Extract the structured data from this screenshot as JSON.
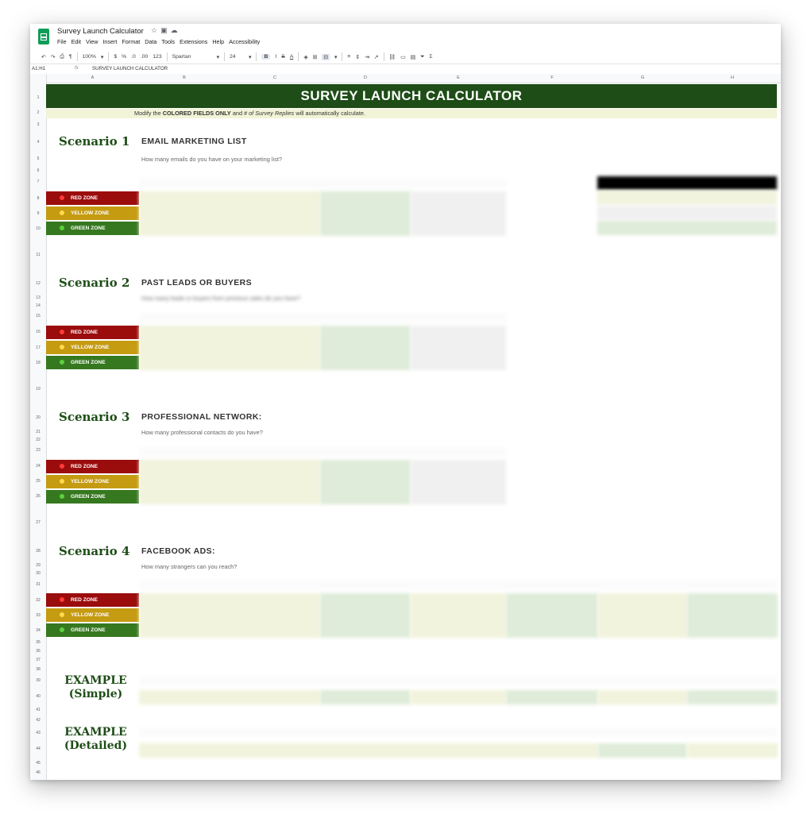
{
  "app": {
    "doc_title": "Survey Launch Calculator",
    "menu": [
      "File",
      "Edit",
      "View",
      "Insert",
      "Format",
      "Data",
      "Tools",
      "Extensions",
      "Help",
      "Accessibility"
    ],
    "toolbar": {
      "zoom": "100%",
      "currency": "$",
      "percent": "%",
      "decimal_less": ".0",
      "decimal_more": ".00",
      "format_more": "123",
      "font": "Spartan",
      "font_size": "24",
      "bold": "B",
      "italic": "I",
      "strike": "S",
      "text_color": "A"
    },
    "name_box": "A1:H1",
    "fx": "fx",
    "formula": "SURVEY LAUNCH CALCULATOR"
  },
  "columns": [
    "A",
    "B",
    "C",
    "D",
    "E",
    "F",
    "G",
    "H"
  ],
  "rows": [
    "1",
    "2",
    "3",
    "4",
    "5",
    "6",
    "7",
    "8",
    "9",
    "10",
    "11",
    "12",
    "13",
    "14",
    "15",
    "16",
    "17",
    "18",
    "19",
    "20",
    "21",
    "22",
    "23",
    "24",
    "25",
    "26",
    "27",
    "28",
    "29",
    "30",
    "31",
    "32",
    "33",
    "34",
    "35",
    "36",
    "37",
    "38",
    "39",
    "40",
    "41",
    "42",
    "43",
    "44",
    "45",
    "46"
  ],
  "sheet": {
    "banner": "SURVEY LAUNCH CALCULATOR",
    "instruction_pre": "Modify the ",
    "instruction_bold": "COLORED FIELDS ONLY",
    "instruction_mid": " and ",
    "instruction_italic": "# of Survey Replies",
    "instruction_post": " will automatically calculate."
  },
  "zones": {
    "red": "RED ZONE",
    "yellow": "YELLOW ZONE",
    "green": "GREEN ZONE"
  },
  "scenarios": [
    {
      "label": "Scenario 1",
      "heading": "EMAIL MARKETING LIST",
      "question": "How many emails do you have on your marketing list?"
    },
    {
      "label": "Scenario 2",
      "heading": "PAST LEADS OR BUYERS",
      "question": "How many leads or buyers from previous sales do you have?"
    },
    {
      "label": "Scenario 3",
      "heading": "PROFESSIONAL NETWORK:",
      "question": "How many professional contacts do you have?"
    },
    {
      "label": "Scenario 4",
      "heading": "FACEBOOK ADS:",
      "question": "How many strangers can you reach?"
    }
  ],
  "examples": {
    "simple_line1": "EXAMPLE",
    "simple_line2": "(Simple)",
    "detailed_line1": "EXAMPLE",
    "detailed_line2": "(Detailed)"
  },
  "colors": {
    "banner": "#1e4d17",
    "instruction_bg": "#f1f4d6",
    "red_zone": "#9b0c0c",
    "yellow_zone": "#c59b12",
    "green_zone": "#36781f",
    "input_cell": "#f1f3dc",
    "output_cell": "#dfecd9"
  }
}
